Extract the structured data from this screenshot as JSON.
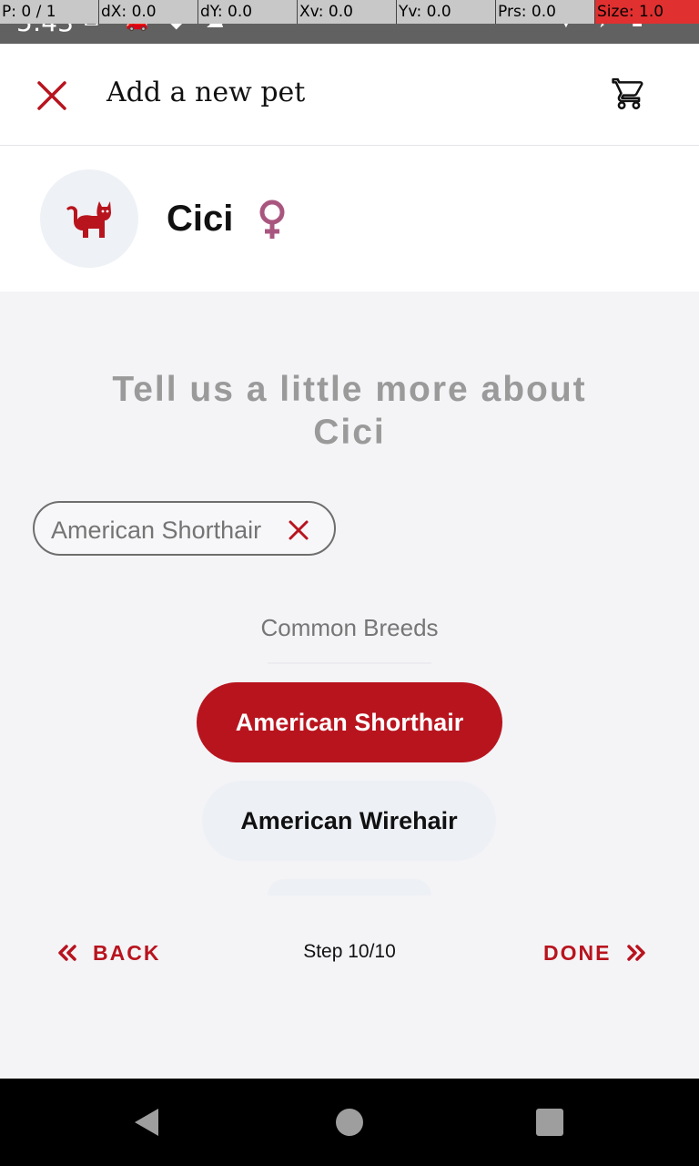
{
  "status_bar": {
    "time": "5:43",
    "pointer_overlay": [
      "P: 0 / 1",
      "dX: 0.0",
      "dY: 0.0",
      "Xv: 0.0",
      "Yv: 0.0",
      "Prs: 0.0",
      "Size: 1.0"
    ]
  },
  "app_bar": {
    "title": "Add a new pet",
    "close_icon": "close-icon",
    "cart_icon": "cart-icon"
  },
  "pet": {
    "name": "Cici",
    "avatar_icon": "cat-icon",
    "gender_icon": "female-icon"
  },
  "main": {
    "prompt": "Tell us a little more about Cici",
    "selected_chip": "American Shorthair",
    "section_label": "Common Breeds",
    "breeds": [
      {
        "label": "American Shorthair",
        "selected": true
      },
      {
        "label": "American Wirehair",
        "selected": false
      }
    ]
  },
  "footer": {
    "back_label": "BACK",
    "step_label": "Step 10/10",
    "done_label": "DONE"
  },
  "colors": {
    "accent": "#b8141e",
    "gender": "#a9567f",
    "chip_background": "#edf0f5"
  }
}
